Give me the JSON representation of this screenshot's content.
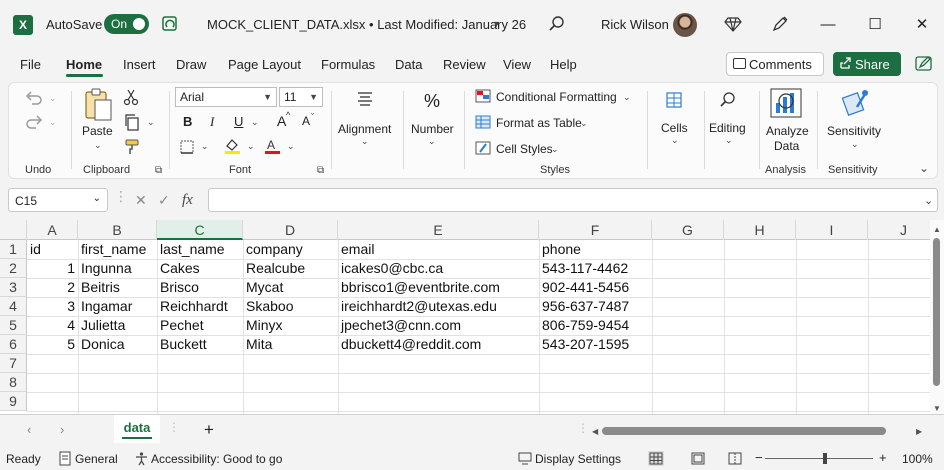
{
  "titlebar": {
    "app_logo": "X",
    "autosave_label": "AutoSave",
    "autosave_state": "On",
    "doc_title": "MOCK_CLIENT_DATA.xlsx • Last Modified: January 26",
    "user_name": "Rick Wilson",
    "minimize": "—",
    "maximize": "☐",
    "close": "✕"
  },
  "menu": {
    "tabs": [
      "File",
      "Home",
      "Insert",
      "Draw",
      "Page Layout",
      "Formulas",
      "Data",
      "Review",
      "View",
      "Help"
    ],
    "active": "Home",
    "comments_label": "Comments",
    "share_label": "Share"
  },
  "ribbon": {
    "undo_group": "Undo",
    "clipboard_group": "Clipboard",
    "paste_label": "Paste",
    "font_group": "Font",
    "font_name": "Arial",
    "font_size": "11",
    "bold": "B",
    "italic": "I",
    "underline": "U",
    "grow_font": "A",
    "shrink_font": "A",
    "alignment_label": "Alignment",
    "number_label": "Number",
    "number_symbol": "%",
    "styles_group": "Styles",
    "conditional_formatting": "Conditional Formatting",
    "format_as_table": "Format as Table",
    "cell_styles": "Cell Styles",
    "cells_label": "Cells",
    "editing_label": "Editing",
    "analyze_data_line1": "Analyze",
    "analyze_data_line2": "Data",
    "analysis_group": "Analysis",
    "sensitivity_label": "Sensitivity",
    "sensitivity_group": "Sensitivity"
  },
  "formula_bar": {
    "name_box": "C15",
    "cancel": "✕",
    "enter": "✓",
    "fx": "fx",
    "value": ""
  },
  "grid": {
    "columns": [
      "A",
      "B",
      "C",
      "D",
      "E",
      "F",
      "G",
      "H",
      "I",
      "J"
    ],
    "selected_column": "C",
    "row_numbers": [
      "1",
      "2",
      "3",
      "4",
      "5",
      "6",
      "7",
      "8",
      "9"
    ],
    "headers": [
      "id",
      "first_name",
      "last_name",
      "company",
      "email",
      "phone"
    ],
    "rows": [
      [
        "1",
        "Ingunna",
        "Cakes",
        "Realcube",
        "icakes0@cbc.ca",
        "543-117-4462"
      ],
      [
        "2",
        "Beitris",
        "Brisco",
        "Mycat",
        "bbrisco1@eventbrite.com",
        "902-441-5456"
      ],
      [
        "3",
        "Ingamar",
        "Reichhardt",
        "Skaboo",
        "ireichhardt2@utexas.edu",
        "956-637-7487"
      ],
      [
        "4",
        "Julietta",
        "Pechet",
        "Minyx",
        "jpechet3@cnn.com",
        "806-759-9454"
      ],
      [
        "5",
        "Donica",
        "Buckett",
        "Mita",
        "dbuckett4@reddit.com",
        "543-207-1595"
      ]
    ]
  },
  "sheets": {
    "tabs": [
      "data"
    ],
    "add_sheet": "+"
  },
  "status": {
    "ready": "Ready",
    "general": "General",
    "accessibility": "Accessibility: Good to go",
    "display_settings": "Display Settings",
    "zoom_minus": "−",
    "zoom_plus": "+",
    "zoom": "100%"
  },
  "colors": {
    "accent": "#1d6f42",
    "share_button": "#1d6f42",
    "font_color_red": "#e81123",
    "highlight_yellow": "#ffe600"
  }
}
